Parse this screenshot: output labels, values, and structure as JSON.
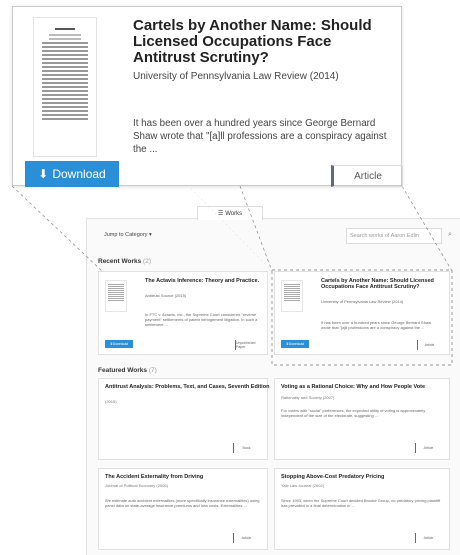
{
  "popup": {
    "title": "Cartels by Another Name: Should Licensed Occupations Face Antitrust Scrutiny?",
    "venue": "University of Pennsylvania Law Review (2014)",
    "abstract": "It has been over a hundred years since George Bernard Shaw wrote that \"[a]ll professions are a conspiracy against the ...",
    "download_label": "Download",
    "type_label": "Article"
  },
  "page": {
    "tab_label": "Works",
    "jump_label": "Jump to Category",
    "search_placeholder": "Search works of Aaron Edlin",
    "recent_heading": "Recent Works",
    "recent_count": "(2)",
    "featured_heading": "Featured Works",
    "featured_count": "(7)"
  },
  "recent_works": [
    {
      "title": "The Actavis Inference: Theory and Practice.",
      "venue": "Antitrust Source (2015)",
      "abstract": "In FTC v. Actavis, Inc., the Supreme Court considered \"reverse payment\" settlements of patent infringement litigation. In such a settlement ...",
      "download_label": "Download",
      "type_label": "Unpublished Paper"
    },
    {
      "title": "Cartels by Another Name: Should Licensed Occupations Face Antitrust Scrutiny?",
      "venue": "University of Pennsylvania Law Review (2014)",
      "abstract": "It has been over a hundred years since George Bernard Shaw wrote that \"[a]ll professions are a conspiracy against the ...",
      "download_label": "Download",
      "type_label": "Article"
    }
  ],
  "featured_works": [
    {
      "title": "Antitrust Analysis: Problems, Text, and Cases, Seventh Edition",
      "venue": "(2015)",
      "abstract": "",
      "type_label": "Book"
    },
    {
      "title": "Voting as a Rational Choice: Why and How People Vote",
      "venue": "Rationality and Society (2007)",
      "abstract": "For voters with \"social\" preferences, the expected utility of voting is approximately independent of the size of the electorate, suggesting ...",
      "type_label": "Article"
    },
    {
      "title": "The Accident Externality from Driving",
      "venue": "Journal of Political Economy (2006)",
      "abstract": "We estimate auto accident externalities (more specifically insurance externalities) using panel data on state-average insurance premiums and loss costs. Externalities ...",
      "type_label": "Article"
    },
    {
      "title": "Stopping Above-Cost Predatory Pricing",
      "venue": "Yale Law Journal (2002)",
      "abstract": "Since 1993, when the Supreme Court decided Brooke Group, no predatory pricing plaintiff has prevailed in a final determination in ...",
      "type_label": "Article"
    }
  ],
  "icons": {
    "download": "download-icon",
    "works": "works-grid-icon",
    "search": "search-icon",
    "caret": "caret-down-icon"
  },
  "colors": {
    "accent": "#2b8fd8",
    "type_border": "#5a6a80"
  }
}
